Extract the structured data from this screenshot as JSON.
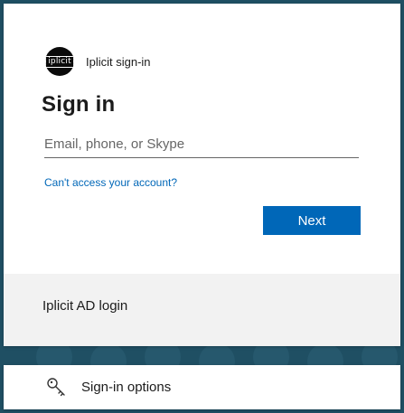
{
  "brand": {
    "logo_text": "iplicit",
    "name": "Iplicit sign-in"
  },
  "signin": {
    "title": "Sign in",
    "email_value": "",
    "email_placeholder": "Email, phone, or Skype",
    "help_link": "Can't access your account?",
    "next_button": "Next"
  },
  "footer": {
    "text": "Iplicit AD login"
  },
  "options": {
    "icon": "key-icon",
    "label": "Sign-in options"
  },
  "colors": {
    "background": "#1f4f63",
    "accent": "#0067b8",
    "link": "#0067b8",
    "footer_bg": "#f2f2f2"
  }
}
